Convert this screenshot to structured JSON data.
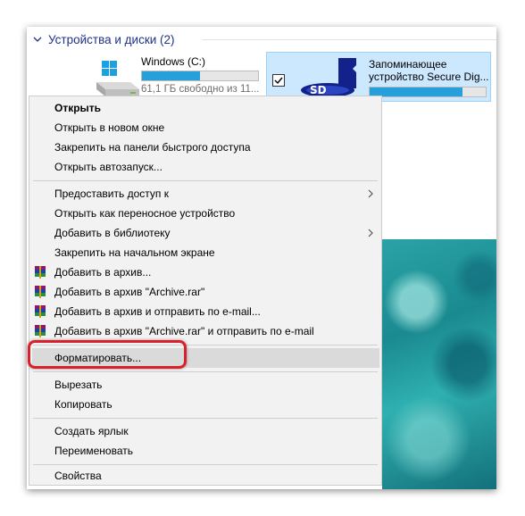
{
  "group": {
    "title": "Устройства и диски (2)"
  },
  "drives": {
    "c": {
      "name": "Windows (C:)",
      "free": "61,1 ГБ свободно из 11...",
      "used_fraction": 0.5
    },
    "sd": {
      "name": "Запоминающее устройство Secure Dig...",
      "used_fraction": 0.8
    }
  },
  "menu": {
    "open": "Открыть",
    "open_new_window": "Открыть в новом окне",
    "pin_quick_access": "Закрепить на панели быстрого доступа",
    "autoplay": "Открыть автозапуск...",
    "share": "Предоставить доступ к",
    "open_portable": "Открыть как переносное устройство",
    "add_library": "Добавить в библиотеку",
    "pin_start": "Закрепить на начальном экране",
    "rar_add": "Добавить в архив...",
    "rar_add_named": "Добавить в архив \"Archive.rar\"",
    "rar_add_email": "Добавить в архив и отправить по e-mail...",
    "rar_add_named_email": "Добавить в архив \"Archive.rar\" и отправить по e-mail",
    "format": "Форматировать...",
    "cut": "Вырезать",
    "copy": "Копировать",
    "shortcut": "Создать ярлык",
    "rename": "Переименовать",
    "properties": "Свойства"
  },
  "colors": {
    "accent": "#26a0da",
    "highlight_ring": "#d9212b",
    "selection": "#cce8ff"
  }
}
